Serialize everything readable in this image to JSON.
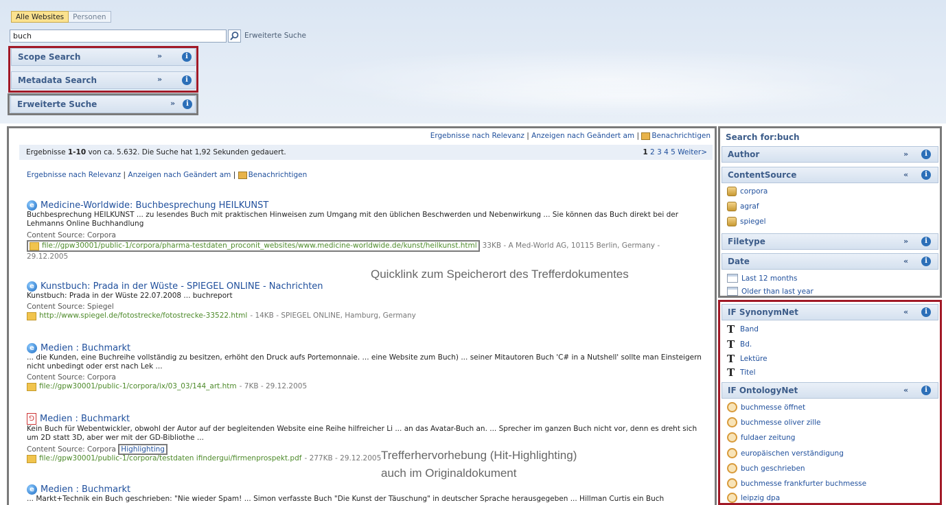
{
  "tabs": {
    "all": "Alle Websites",
    "people": "Personen"
  },
  "search": {
    "value": "buch",
    "advanced_link": "Erweiterte Suche"
  },
  "panels": {
    "scope": "Scope Search",
    "metadata": "Metadata Search",
    "advanced": "Erweiterte Suche"
  },
  "results_header": {
    "sort_relevance": "Ergebnisse nach Relevanz",
    "sep1": " | ",
    "sort_modified": "Anzeigen nach Geändert am",
    "sep2": " | ",
    "alert": "Benachrichtigen",
    "stats_pre": "Ergebnisse ",
    "stats_range": "1-10",
    "stats_post": " von ca. 5.632. Die Suche hat 1,92 Sekunden gedauert.",
    "pages": [
      "1",
      "2",
      "3",
      "4",
      "5"
    ],
    "next": "Weiter>"
  },
  "results": [
    {
      "title": "Medicine-Worldwide: Buchbesprechung HEILKUNST",
      "snippet1": "Buchbesprechung HEILKUNST ... zu lesendes Buch mit praktischen Hinweisen zum Umgang mit den üblichen Beschwerden und Nebenwirkung ... Sie können das Buch direkt bei der",
      "snippet2": "Lehmanns Online Buchhandlung",
      "source": "Content Source: Corpora",
      "url": "file://gpw30001/public-1/corpora/pharma-testdaten_proconit_websites/www.medicine-worldwide.de/kunst/heilkunst.html",
      "meta": "33KB - A Med-World AG, 10115 Berlin, Germany -",
      "meta2": "29.12.2005"
    },
    {
      "title": "Kunstbuch: Prada in der Wüste - SPIEGEL ONLINE - Nachrichten",
      "snippet1": "Kunstbuch: Prada in der Wüste 22.07.2008 ... buchreport",
      "source": "Content Source: Spiegel",
      "url": "http://www.spiegel.de/fotostrecke/fotostrecke-33522.html",
      "meta": "- 14KB - SPIEGEL ONLINE, Hamburg, Germany"
    },
    {
      "title": "Medien : Buchmarkt",
      "snippet1": "... die Kunden, eine Buchreihe vollständig zu besitzen, erhöht den Druck aufs Portemonnaie. ... eine Website zum Buch) ... seiner Mitautoren Buch 'C# in a Nutshell' sollte man Einsteigern",
      "snippet2": "nicht unbedingt oder erst nach Lek ...",
      "source": "Content Source: Corpora",
      "url": "file://gpw30001/public-1/corpora/ix/03_03/144_art.htm",
      "meta": "- 7KB - 29.12.2005"
    },
    {
      "title": "Medien : Buchmarkt",
      "snippet1": "Kein Buch für Webentwickler, obwohl der Autor auf der begleitenden Website eine Reihe hilfreicher Li ... an das Avatar-Buch an. ... Sprecher im ganzen Buch nicht vor, denn es dreht sich",
      "snippet2": "um 2D statt 3D, aber wer mit der GD-Bibliothe ...",
      "source": "Content Source: Corpora",
      "highlight": "Highlighting",
      "url": "file://gpw30001/public-1/corpora/testdaten ifindergui/firmenprospekt.pdf",
      "meta": "- 277KB - 29.12.2005"
    },
    {
      "title": "Medien : Buchmarkt",
      "snippet1": "... Markt+Technik ein Buch geschrieben: \"Nie wieder Spam! ... Simon verfasste Buch \"Die Kunst der Täuschung\" in deutscher Sprache herausgegeben ... Hillman Curtis ein Buch"
    }
  ],
  "annotations": {
    "quicklink": "Quicklink zum Speicherort des Trefferdokumentes",
    "hl1": "Trefferhervorhebung (Hit-Highlighting)",
    "hl2": "auch im Originaldokument"
  },
  "rail": {
    "search_for": "Search for:buch",
    "author": "Author",
    "content_source": "ContentSource",
    "sources": [
      "corpora",
      "agraf",
      "spiegel"
    ],
    "filetype": "Filetype",
    "date": "Date",
    "dates": [
      "Last 12 months",
      "Older than last year"
    ],
    "synonym": "IF SynonymNet",
    "synonyms": [
      "Band",
      "Bd.",
      "Lektüre",
      "Titel"
    ],
    "ontology": "IF OntologyNet",
    "ontologies": [
      "buchmesse öffnet",
      "buchmesse oliver zille",
      "fuldaer zeitung",
      "europäischen verständigung",
      "buch geschrieben",
      "buchmesse frankfurter buchmesse",
      "leipzig dpa"
    ]
  },
  "colors": {
    "highlight_red": "#a11826",
    "highlight_gray": "#7a7a7a",
    "link_blue": "#1f4f9c",
    "url_green": "#4d8a2a"
  }
}
